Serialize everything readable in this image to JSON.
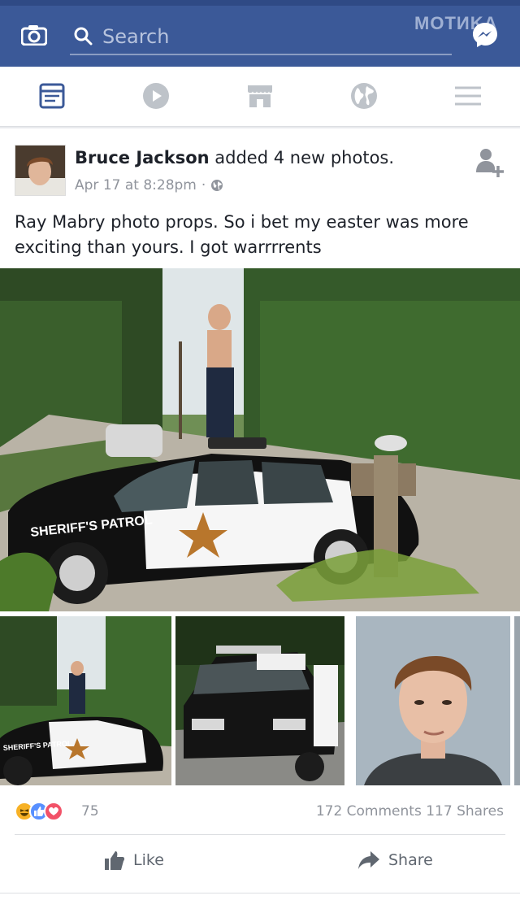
{
  "header": {
    "search_placeholder": "Search",
    "watermark": "MOTИKA",
    "brand_color": "#3b5998",
    "icons": [
      "camera-icon",
      "search-icon",
      "messenger-icon"
    ]
  },
  "nav": {
    "tabs": [
      "news-feed-icon",
      "video-icon",
      "marketplace-icon",
      "globe-icon",
      "menu-icon"
    ],
    "active": "news-feed-icon",
    "active_color": "#3b5998"
  },
  "post": {
    "author": "Bruce Jackson",
    "action": "added 4 new photos.",
    "timestamp": "Apr 17 at 8:28pm",
    "separator": "·",
    "privacy_icon": "globe-icon",
    "text": "Ray Mabry photo props. So i bet my easter was more exciting than yours. I got warrrrents",
    "photos": {
      "main_patrol_label": "SHERIFF'S PATROL",
      "thumb_patrol_label": "SHERIFF'S PATROL"
    }
  },
  "engagement": {
    "reaction_count": "75",
    "comments": "172 Comments",
    "shares": "117 Shares",
    "reaction_icons": [
      "haha-icon",
      "like-icon",
      "love-icon"
    ]
  },
  "actions": {
    "like": "Like",
    "share": "Share"
  }
}
